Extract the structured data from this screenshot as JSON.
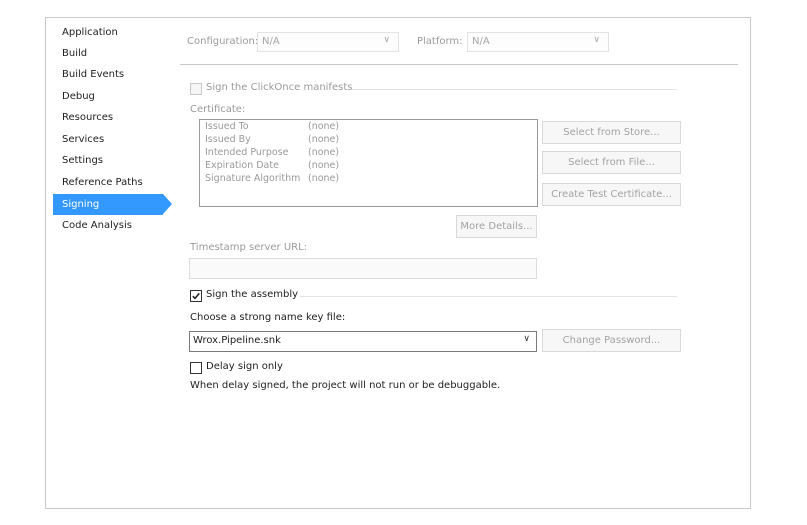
{
  "sidebar": {
    "items": [
      {
        "label": "Application"
      },
      {
        "label": "Build"
      },
      {
        "label": "Build Events"
      },
      {
        "label": "Debug"
      },
      {
        "label": "Resources"
      },
      {
        "label": "Services"
      },
      {
        "label": "Settings"
      },
      {
        "label": "Reference Paths"
      },
      {
        "label": "Signing",
        "selected": true
      },
      {
        "label": "Code Analysis"
      }
    ]
  },
  "toolbar": {
    "configuration_label": "Configuration:",
    "configuration_value": "N/A",
    "platform_label": "Platform:",
    "platform_value": "N/A"
  },
  "clickonce": {
    "checkbox_label": "Sign the ClickOnce manifests",
    "checked": false,
    "enabled": false,
    "certificate_label": "Certificate:",
    "certificate_rows": [
      {
        "key": "Issued To",
        "value": "(none)"
      },
      {
        "key": "Issued By",
        "value": "(none)"
      },
      {
        "key": "Intended Purpose",
        "value": "(none)"
      },
      {
        "key": "Expiration Date",
        "value": "(none)"
      },
      {
        "key": "Signature Algorithm",
        "value": "(none)"
      }
    ],
    "select_from_store": "Select from Store...",
    "select_from_file": "Select from File...",
    "create_test_certificate": "Create Test Certificate...",
    "more_details": "More Details...",
    "timestamp_label": "Timestamp server URL:",
    "timestamp_value": ""
  },
  "assembly": {
    "checkbox_label": "Sign the assembly",
    "checked": true,
    "key_file_label": "Choose a strong name key file:",
    "key_file_value": "Wrox.Pipeline.snk",
    "change_password": "Change Password...",
    "delay_sign_label": "Delay sign only",
    "delay_sign_checked": false,
    "delay_sign_note": "When delay signed, the project will not run or be debuggable."
  },
  "colors": {
    "accent": "#3399ff",
    "disabled_text": "#9a9a9a"
  },
  "icons": {
    "chevron": "chevron-down-icon",
    "check": "checkmark-icon"
  }
}
